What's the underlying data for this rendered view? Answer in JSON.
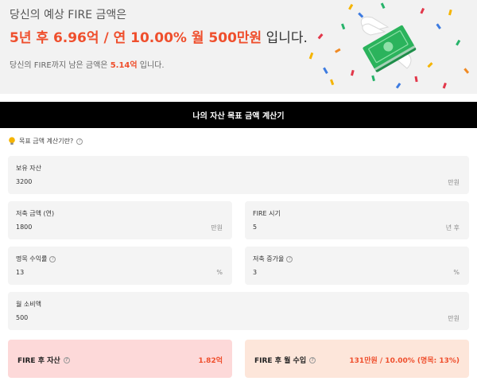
{
  "hero": {
    "line1": "당신의 예상 FIRE 금액은",
    "line2": {
      "highlight": "5년 후 6.96억 / 연 10.00% 월 500만원",
      "suffix": " 입니다."
    },
    "line3": {
      "prefix": "당신의 FIRE까지 남은 금액은 ",
      "highlight": "5.14억",
      "suffix": " 입니다."
    }
  },
  "calculator": {
    "title": "나의 자산 목표 금액 계산기",
    "guide_label": "목표 금액 계산기란?"
  },
  "fields": {
    "assets": {
      "label": "보유 자산",
      "value": "3200",
      "unit": "만원"
    },
    "savings": {
      "label": "저축 금액 (연)",
      "value": "1800",
      "unit": "만원"
    },
    "fire_period": {
      "label": "FIRE 시기",
      "value": "5",
      "unit": "년 후"
    },
    "nominal_return": {
      "label": "명목 수익률",
      "value": "13",
      "unit": "%"
    },
    "savings_growth": {
      "label": "저축 증가율",
      "value": "3",
      "unit": "%"
    },
    "monthly_spend": {
      "label": "월 소비액",
      "value": "500",
      "unit": "만원"
    }
  },
  "results": {
    "assets_after": {
      "label": "FIRE 후 자산",
      "value": "1.82억"
    },
    "monthly_income": {
      "label": "FIRE 후 월 수입",
      "value": "131만원 / 10.00% (명목: 13%)"
    }
  },
  "colors": {
    "accent": "#ef4f2d",
    "hero_bg": "#f2f2f2",
    "header_bg": "#000000",
    "card_bg": "#f4f4f4",
    "result_assets_bg": "#fdd9d9",
    "result_income_bg": "#fde6da"
  },
  "icons": {
    "guide": "lightbulb-icon",
    "help": "question-circle-icon",
    "hero": "flying-money-icon"
  }
}
